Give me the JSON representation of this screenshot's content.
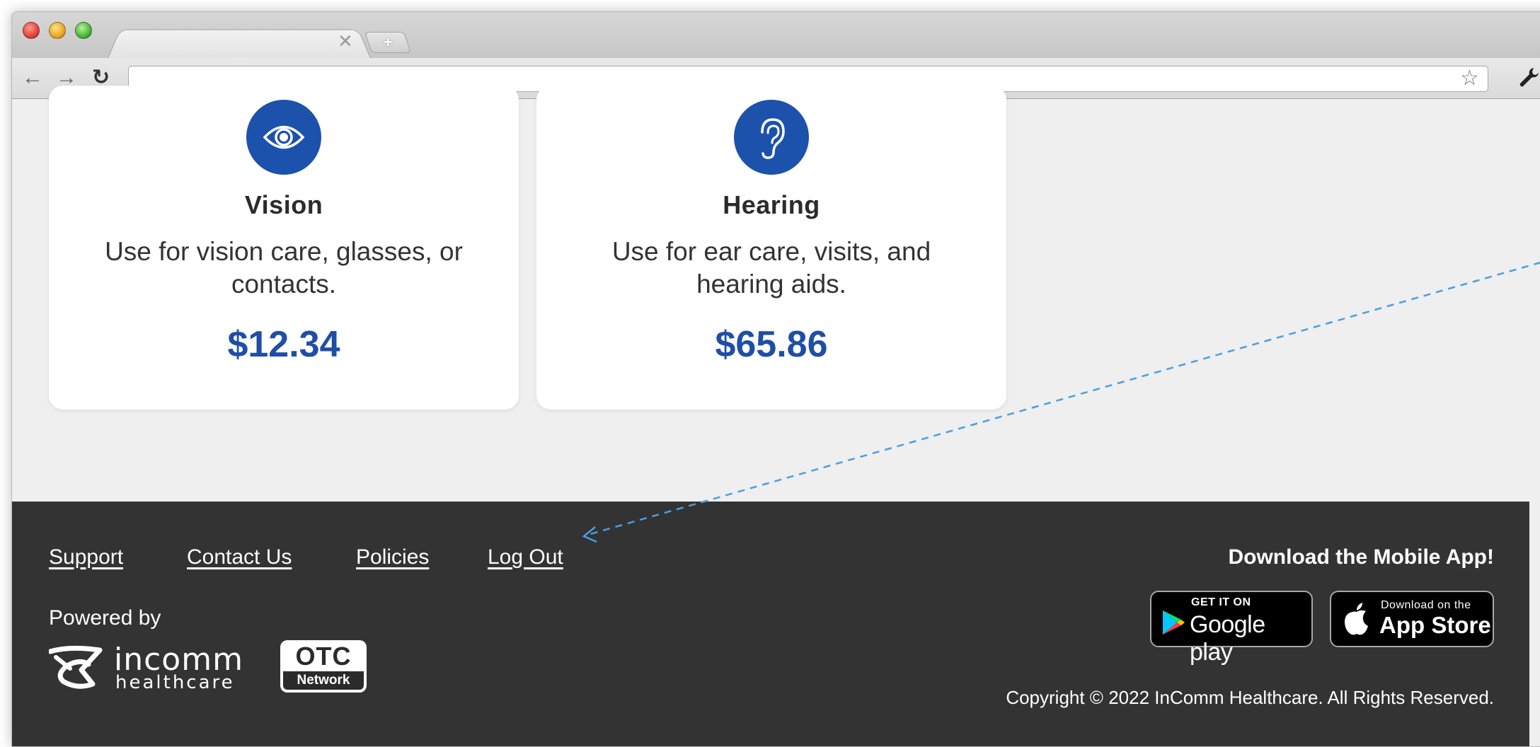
{
  "browser": {
    "icons": {
      "back": "back-arrow-icon",
      "forward": "forward-arrow-icon",
      "reload": "reload-icon",
      "bookmark": "star-icon",
      "settings": "wrench-icon",
      "close_tab": "close-icon",
      "new_tab": "plus-icon"
    },
    "address": ""
  },
  "cards": [
    {
      "title": "Vision",
      "description": "Use for vision care, glasses, or contacts.",
      "amount": "$12.34",
      "icon": "eye-icon"
    },
    {
      "title": "Hearing",
      "description": "Use for ear care, visits, and hearing aids.",
      "amount": "$65.86",
      "icon": "ear-icon"
    }
  ],
  "footer": {
    "links": {
      "support": "Support",
      "contact": "Contact Us",
      "policies": "Policies",
      "logout": "Log Out"
    },
    "powered_by": "Powered by",
    "logo": {
      "brand": "incomm",
      "sub": "healthcare"
    },
    "otc_badge": {
      "top": "OTC",
      "bottom": "Network"
    },
    "app_heading": "Download the Mobile App!",
    "google_play": {
      "small": "GET IT ON",
      "big": "Google play"
    },
    "app_store": {
      "small": "Download on the",
      "big": "App Store"
    },
    "copyright": "Copyright © 2022 InComm Healthcare. All Rights Reserved."
  },
  "colors": {
    "accent_blue": "#1f4ea5",
    "footer_bg": "#333333",
    "page_bg": "#efefef",
    "annotation": "#4a9fe0"
  }
}
